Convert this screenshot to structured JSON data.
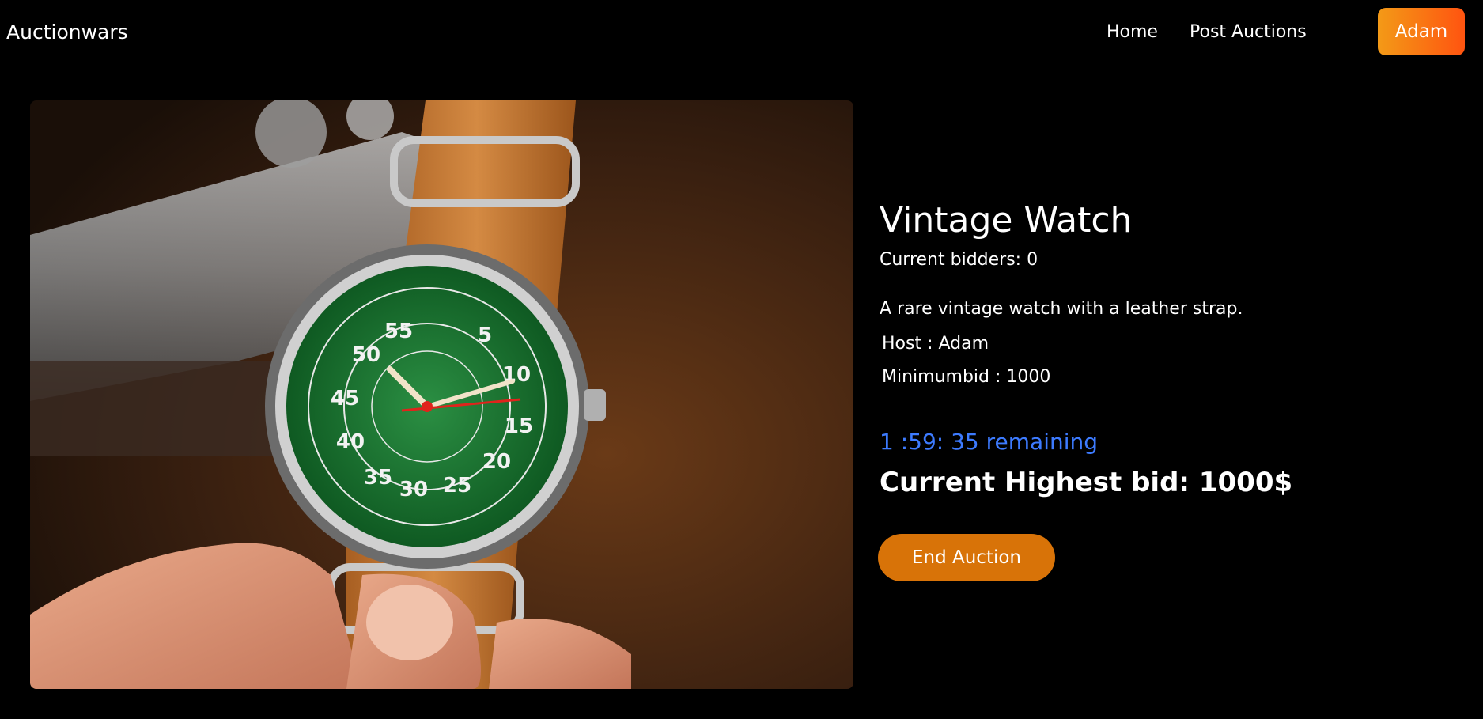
{
  "navbar": {
    "brand": "Auctionwars",
    "links": [
      "Home",
      "Post Auctions"
    ],
    "user": "Adam"
  },
  "auction": {
    "title": "Vintage Watch",
    "bidders": "Current bidders: 0",
    "description": "A rare vintage watch with a leather strap.",
    "host": "Host : Adam",
    "minimum_bid": "Minimumbid : 1000",
    "time_remaining": "1 :59: 35 remaining",
    "highest_bid": "Current Highest bid: 1000$",
    "end_button": "End Auction"
  },
  "image": {
    "subject": "vintage-watch-photo",
    "dial_numbers": [
      "55",
      "5",
      "50",
      "10",
      "45",
      "15",
      "40",
      "20",
      "35",
      "30",
      "25"
    ]
  },
  "colors": {
    "background": "#000000",
    "timer": "#3d7bff",
    "end_button": "#d87308",
    "user_gradient_start": "#f39a17",
    "user_gradient_end": "#ff5410",
    "dial": "#1e7a34",
    "strap": "#c87a35"
  }
}
